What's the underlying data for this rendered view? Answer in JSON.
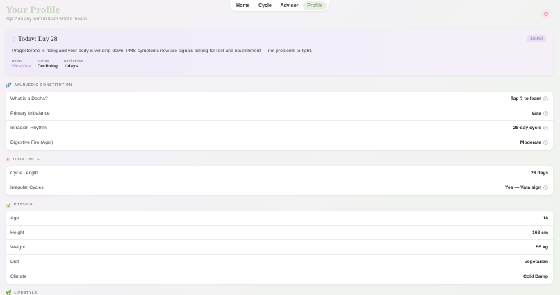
{
  "page": {
    "title": "Your Profile",
    "subtitle": "Tap ? on any term to learn what it means",
    "flower_icon": "flower-icon"
  },
  "nav": {
    "tabs": [
      {
        "label": "Home",
        "active": false
      },
      {
        "label": "Cycle",
        "active": false
      },
      {
        "label": "Advisor",
        "active": false
      },
      {
        "label": "Profile",
        "active": true
      }
    ]
  },
  "today": {
    "title": "Today: Day 28",
    "icon": "moon-icon",
    "phase": "Luteal",
    "description": "Progesterone is rising and your body is winding down. PMS symptoms now are signals asking for rest and nourishment — not problems to fight.",
    "stats": [
      {
        "label": "Dosha",
        "value": "Pitta/Vata"
      },
      {
        "label": "Energy",
        "value": "Declining"
      },
      {
        "label": "Until period",
        "value": "1 days"
      }
    ]
  },
  "sections": {
    "constitution": {
      "title": "AYURVEDIC CONSTITUTION",
      "icon": "dna-icon",
      "rows": [
        {
          "label": "What is a Dosha?",
          "value": "Tap ? to learn",
          "info": true
        },
        {
          "label": "Primary Imbalance",
          "value": "Vata",
          "info": true
        },
        {
          "label": "Infradian Rhythm",
          "value": "28-day cycle",
          "info": true
        },
        {
          "label": "Digestive Fire (Agni)",
          "value": "Moderate",
          "info": true
        }
      ]
    },
    "cycle": {
      "title": "YOUR CYCLE",
      "icon": "flower-icon",
      "rows": [
        {
          "label": "Cycle Length",
          "value": "28 days",
          "info": false
        },
        {
          "label": "Irregular Cycles",
          "value": "Yes — Vata sign",
          "info": true
        }
      ]
    },
    "physical": {
      "title": "PHYSICAL",
      "icon": "bar-chart-icon",
      "rows": [
        {
          "label": "Age",
          "value": "18",
          "info": false
        },
        {
          "label": "Height",
          "value": "168 cm",
          "info": false
        },
        {
          "label": "Weight",
          "value": "55 kg",
          "info": false
        },
        {
          "label": "Diet",
          "value": "Vegetarian",
          "info": false
        },
        {
          "label": "Climate",
          "value": "Cold Damp",
          "info": false
        }
      ]
    },
    "lifestyle": {
      "title": "LIFESTYLE",
      "icon": "leaf-icon"
    }
  }
}
